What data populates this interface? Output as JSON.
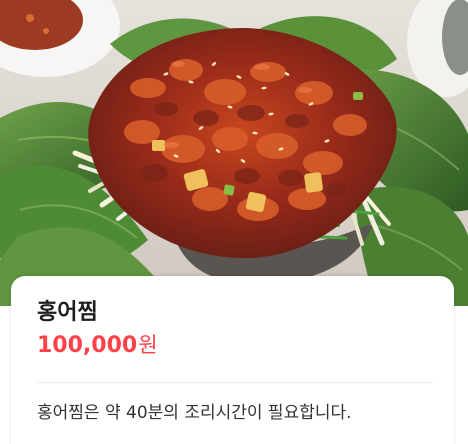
{
  "product": {
    "name": "홍어찜",
    "price_amount": "100,000",
    "price_unit": "원",
    "description": "홍어찜은 약 40분의 조리시간이 필요합니다."
  },
  "colors": {
    "price": "#ff4148",
    "title": "#1f1f1f",
    "description": "#333333",
    "divider": "#ececec"
  }
}
